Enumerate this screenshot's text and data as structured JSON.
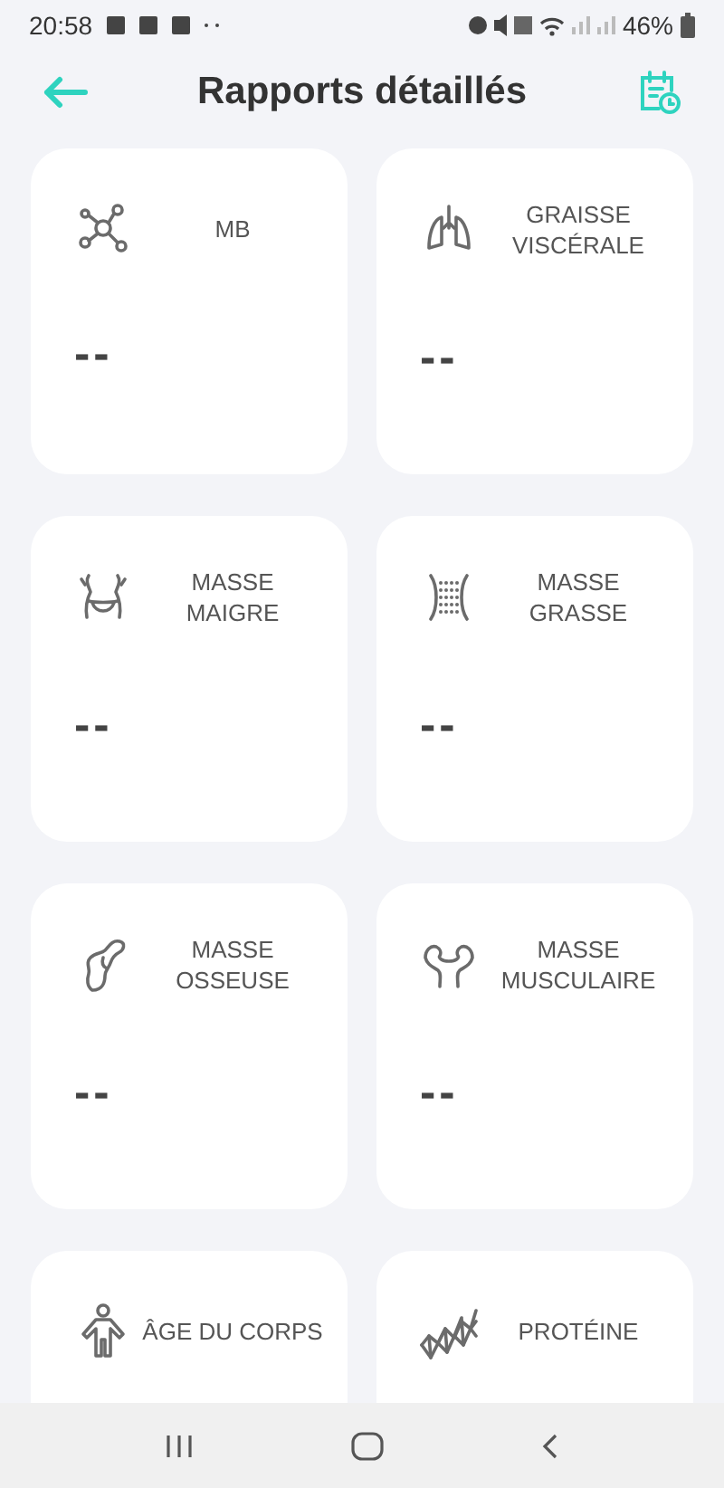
{
  "status_bar": {
    "time": "20:58",
    "battery": "46%"
  },
  "header": {
    "title": "Rapports détaillés"
  },
  "cards": [
    {
      "kind": "molecule",
      "label_lines": [
        "MB"
      ],
      "value": "--"
    },
    {
      "kind": "lungs",
      "label_lines": [
        "GRAISSE",
        "VISCÉRALE"
      ],
      "value": "--"
    },
    {
      "kind": "waist",
      "label_lines": [
        "MASSE",
        "MAIGRE"
      ],
      "value": "--"
    },
    {
      "kind": "fat",
      "label_lines": [
        "MASSE",
        "GRASSE"
      ],
      "value": "--"
    },
    {
      "kind": "bone",
      "label_lines": [
        "MASSE",
        "OSSEUSE"
      ],
      "value": "--"
    },
    {
      "kind": "muscle",
      "label_lines": [
        "MASSE",
        "MUSCULAIRE"
      ],
      "value": "--"
    },
    {
      "kind": "person",
      "label_lines": [
        "ÂGE DU CORPS"
      ]
    },
    {
      "kind": "protein",
      "label_lines": [
        "PROTÉINE"
      ]
    }
  ]
}
